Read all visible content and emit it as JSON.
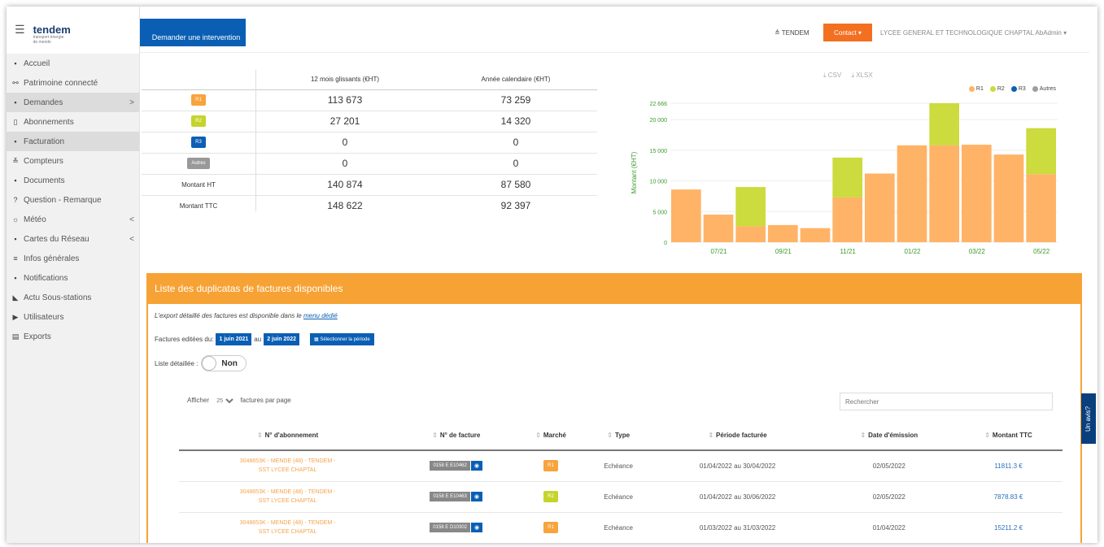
{
  "brand": {
    "name": "tendem",
    "tagline1": "transport énergie",
    "tagline2": "de mende"
  },
  "sidebar": {
    "items": [
      {
        "label": "Accueil",
        "icon": "home-icon",
        "glyph": "▪",
        "arrow": ""
      },
      {
        "label": "Patrimoine connecté",
        "icon": "plug-icon",
        "glyph": "⚯",
        "arrow": ""
      },
      {
        "label": "Demandes",
        "icon": "inbox-icon",
        "glyph": "▪",
        "arrow": ">"
      },
      {
        "label": "Abonnements",
        "icon": "file-icon",
        "glyph": "▯",
        "arrow": ""
      },
      {
        "label": "Facturation",
        "icon": "invoice-icon",
        "glyph": "▪",
        "arrow": ""
      },
      {
        "label": "Compteurs",
        "icon": "meter-icon",
        "glyph": "≚",
        "arrow": ""
      },
      {
        "label": "Documents",
        "icon": "document-icon",
        "glyph": "▪",
        "arrow": ""
      },
      {
        "label": "Question - Remarque",
        "icon": "question-icon",
        "glyph": "?",
        "arrow": ""
      },
      {
        "label": "Météo",
        "icon": "weather-icon",
        "glyph": "☼",
        "arrow": "<"
      },
      {
        "label": "Cartes du Réseau",
        "icon": "map-icon",
        "glyph": "▪",
        "arrow": "<"
      },
      {
        "label": "Infos générales",
        "icon": "info-icon",
        "glyph": "≡",
        "arrow": ""
      },
      {
        "label": "Notifications",
        "icon": "bell-icon",
        "glyph": "▪",
        "arrow": ""
      },
      {
        "label": "Actu Sous-stations",
        "icon": "news-icon",
        "glyph": "◣",
        "arrow": ""
      },
      {
        "label": "Utilisateurs",
        "icon": "user-icon",
        "glyph": "▶",
        "arrow": ""
      },
      {
        "label": "Exports",
        "icon": "export-icon",
        "glyph": "▤",
        "arrow": ""
      }
    ],
    "active_index": 4,
    "highlight_index": 2
  },
  "topbar": {
    "request_button": "Demander une intervention",
    "tendem_link": "≜ TENDEM",
    "contact_button": "Contact ▾",
    "user": "LYCEE GENERAL ET TECHNOLOGIQUE CHAPTAL AbAdmin ▾"
  },
  "summary": {
    "col1": "12 mois glissants (€HT)",
    "col2": "Année calendaire (€HT)",
    "rows": [
      {
        "label": "R1",
        "tag": "r1",
        "v1": "113 673",
        "v2": "73 259"
      },
      {
        "label": "R2",
        "tag": "r2",
        "v1": "27 201",
        "v2": "14 320"
      },
      {
        "label": "R3",
        "tag": "r3",
        "v1": "0",
        "v2": "0"
      },
      {
        "label": "Autres",
        "tag": "autres",
        "v1": "0",
        "v2": "0"
      },
      {
        "label": "Montant HT",
        "tag": "",
        "v1": "140 874",
        "v2": "87 580"
      },
      {
        "label": "Montant TTC",
        "tag": "",
        "v1": "148 622",
        "v2": "92 397"
      }
    ]
  },
  "chart_downloads": {
    "csv": "⤓ CSV",
    "xlsx": "⤓ XLSX"
  },
  "chart_data": {
    "type": "bar",
    "stacked": true,
    "ylabel": "Montant (€HT)",
    "ylim": [
      0,
      22666
    ],
    "yticks": [
      0,
      5000,
      10000,
      15000,
      20000,
      22666
    ],
    "ytick_labels": [
      "0",
      "5 000",
      "10 000",
      "15 000",
      "20 000",
      "22 666"
    ],
    "categories": [
      "06/21",
      "07/21",
      "08/21",
      "09/21",
      "10/21",
      "11/21",
      "12/21",
      "01/22",
      "02/22",
      "03/22",
      "04/22",
      "05/22"
    ],
    "xtick_labels": [
      "",
      "07/21",
      "",
      "09/21",
      "",
      "11/21",
      "",
      "01/22",
      "",
      "03/22",
      "",
      "05/22"
    ],
    "legend": [
      "R1",
      "R2",
      "R3",
      "Autres"
    ],
    "colors": {
      "R1": "#ffb366",
      "R2": "#ccdb3d",
      "R3": "#0c5fb5",
      "Autres": "#9e9e9e"
    },
    "series": [
      {
        "name": "R1",
        "values": [
          8600,
          4500,
          2600,
          2800,
          2300,
          7300,
          11200,
          15800,
          15800,
          15900,
          14300,
          11100
        ]
      },
      {
        "name": "R2",
        "values": [
          0,
          0,
          6400,
          0,
          0,
          6500,
          0,
          0,
          6866,
          0,
          0,
          7500
        ]
      },
      {
        "name": "R3",
        "values": [
          0,
          0,
          0,
          0,
          0,
          0,
          0,
          0,
          0,
          0,
          0,
          0
        ]
      },
      {
        "name": "Autres",
        "values": [
          0,
          0,
          0,
          0,
          0,
          0,
          0,
          0,
          0,
          0,
          0,
          0
        ]
      }
    ]
  },
  "panel": {
    "title": "Liste des duplicatas de factures disponibles",
    "note": "L'export détaillé des factures est disponible dans le",
    "note_link": "menu dédié",
    "dates_label": "Factures editées du:",
    "date_from": "1 juin 2021",
    "date_sep": "au",
    "date_to": "2 juin 2022",
    "period_button": "▦ Sélectionner la période",
    "detail_label": "Liste détaillée :",
    "detail_value": "Non",
    "show_label": "Afficher",
    "show_value": "25",
    "show_suffix": "factures par page",
    "search_placeholder": "Rechercher"
  },
  "invoices": {
    "headers": [
      "N° d'abonnement",
      "N° de facture",
      "Marché",
      "Type",
      "Période facturée",
      "Date d'émission",
      "Montant TTC"
    ],
    "rows": [
      {
        "sub1": "3048653K - MENDE (48) - TENDEM -",
        "sub2": "SST LYCEE CHAPTAL",
        "invoice": "0158 E E10462",
        "market": "R1",
        "tag": "r1",
        "type": "Echéance",
        "period": "01/04/2022 au 30/04/2022",
        "date": "02/05/2022",
        "amount": "11811.3 €"
      },
      {
        "sub1": "3048653K - MENDE (48) - TENDEM -",
        "sub2": "SST LYCEE CHAPTAL",
        "invoice": "0158 E E10463",
        "market": "R2",
        "tag": "r2",
        "type": "Echéance",
        "period": "01/04/2022 au 30/06/2022",
        "date": "02/05/2022",
        "amount": "7878.83 €"
      },
      {
        "sub1": "3048653K - MENDE (48) - TENDEM -",
        "sub2": "SST LYCEE CHAPTAL",
        "invoice": "0158 E D10302",
        "market": "R1",
        "tag": "r1",
        "type": "Echéance",
        "period": "01/03/2022 au 31/03/2022",
        "date": "01/04/2022",
        "amount": "15211.2 €"
      }
    ]
  },
  "feedback_tab": "Un avis?"
}
